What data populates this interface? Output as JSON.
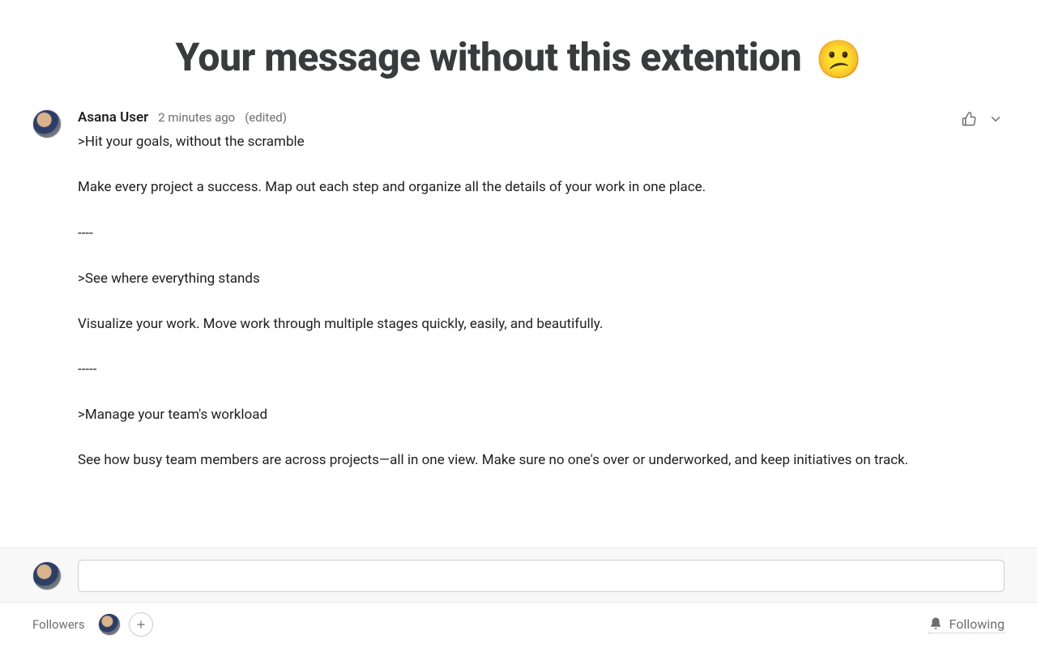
{
  "header": {
    "title": "Your message without this extention",
    "emoji": "😕"
  },
  "comment": {
    "author": "Asana User",
    "timestamp": "2 minutes ago",
    "edited_label": "(edited)",
    "body": ">Hit your goals, without the scramble\n\nMake every project a success. Map out each step and organize all the details of your work in one place.\n\n----\n\n>See where everything stands\n\nVisualize your work. Move work through multiple stages quickly, easily, and beautifully.\n\n-----\n\n>Manage your team's workload\n\nSee how busy team members are across projects—all in one view. Make sure no one's over or underworked, and keep initiatives on track."
  },
  "compose": {
    "placeholder": ""
  },
  "footer": {
    "followers_label": "Followers",
    "following_label": "Following"
  }
}
